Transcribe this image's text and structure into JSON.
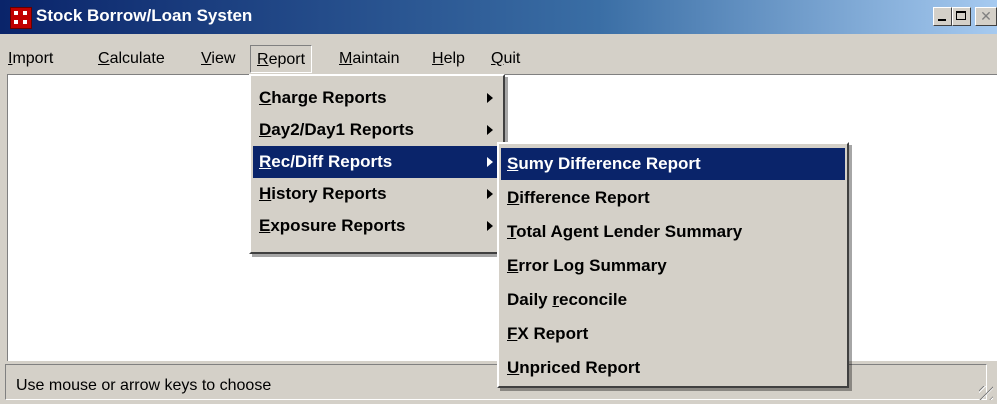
{
  "window": {
    "title": "Stock Borrow/Loan Systen"
  },
  "menubar": {
    "items": [
      {
        "label": "Import"
      },
      {
        "label": "Calculate"
      },
      {
        "label": "View"
      },
      {
        "label": "Report"
      },
      {
        "label": "Maintain"
      },
      {
        "label": "Help"
      },
      {
        "label": "Quit"
      }
    ]
  },
  "report_menu": {
    "items": [
      {
        "accel": "C",
        "rest": "harge Reports"
      },
      {
        "accel": "D",
        "rest": "ay2/Day1 Reports"
      },
      {
        "accel": "R",
        "rest": "ec/Diff Reports"
      },
      {
        "accel": "H",
        "rest": "istory Reports"
      },
      {
        "accel": "E",
        "rest": "xposure Reports"
      }
    ]
  },
  "recdiff_menu": {
    "items": [
      {
        "pre": "",
        "accel": "S",
        "rest": "umy Difference Report"
      },
      {
        "pre": "",
        "accel": "D",
        "rest": "ifference Report"
      },
      {
        "pre": "",
        "accel": "T",
        "rest": "otal Agent Lender Summary"
      },
      {
        "pre": "",
        "accel": "E",
        "rest": "rror Log Summary"
      },
      {
        "pre": "Daily ",
        "accel": "r",
        "rest": "econcile"
      },
      {
        "pre": "",
        "accel": "F",
        "rest": "X Report"
      },
      {
        "pre": "",
        "accel": "U",
        "rest": "npriced Report"
      }
    ]
  },
  "statusbar": {
    "text": "Use mouse or arrow keys to choose"
  },
  "colors": {
    "titlebar": "#0a246a",
    "highlight": "#0a246a",
    "face": "#d4d0c8"
  }
}
